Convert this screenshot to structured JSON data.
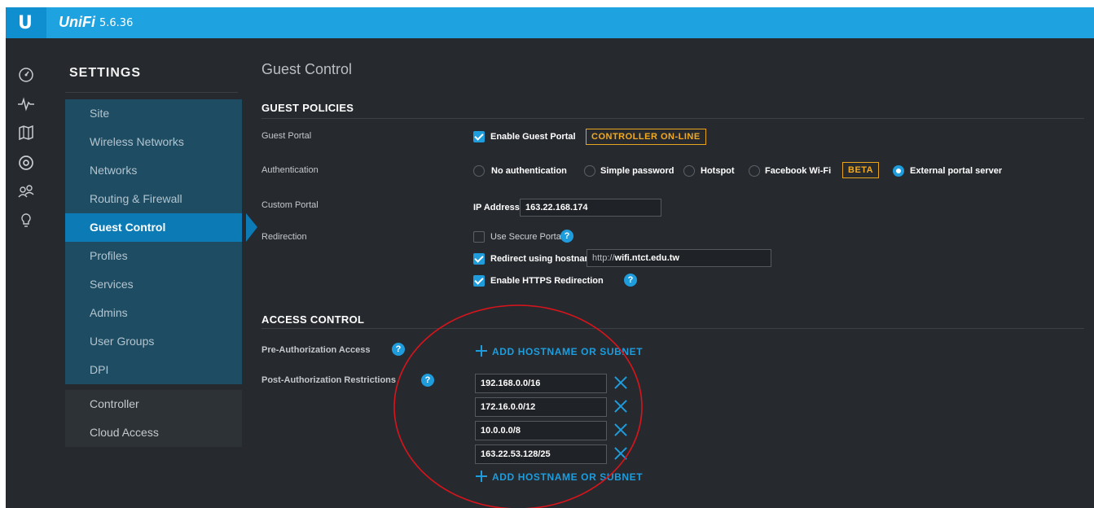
{
  "app": {
    "logo": "U",
    "brand": "UniFi",
    "version": "5.6.36"
  },
  "rail": {
    "icons": [
      "dashboard-icon",
      "statistics-icon",
      "map-icon",
      "devices-icon",
      "clients-icon",
      "insights-icon"
    ]
  },
  "sidebar": {
    "title": "SETTINGS",
    "items": [
      {
        "label": "Site"
      },
      {
        "label": "Wireless Networks"
      },
      {
        "label": "Networks"
      },
      {
        "label": "Routing & Firewall"
      },
      {
        "label": "Guest Control",
        "active": true
      },
      {
        "label": "Profiles"
      },
      {
        "label": "Services"
      },
      {
        "label": "Admins"
      },
      {
        "label": "User Groups"
      },
      {
        "label": "DPI"
      }
    ],
    "secondary_items": [
      {
        "label": "Controller"
      },
      {
        "label": "Cloud Access"
      }
    ]
  },
  "page": {
    "title": "Guest Control",
    "guest_policies": {
      "title": "GUEST POLICIES",
      "guest_portal": {
        "label": "Guest Portal",
        "checkbox_label": "Enable Guest Portal",
        "checked": true,
        "badge": "CONTROLLER ON-LINE"
      },
      "authentication": {
        "label": "Authentication",
        "options": [
          {
            "label": "No authentication",
            "selected": false
          },
          {
            "label": "Simple password",
            "selected": false
          },
          {
            "label": "Hotspot",
            "selected": false
          },
          {
            "label": "Facebook Wi-Fi",
            "selected": false
          },
          {
            "label": "External portal server",
            "selected": true
          }
        ],
        "beta_badge": "BETA"
      },
      "custom_portal": {
        "label": "Custom Portal",
        "ip_label": "IP Address",
        "ip_value": "163.22.168.174"
      },
      "redirection": {
        "label": "Redirection",
        "secure_portal": {
          "label": "Use Secure Portal",
          "checked": false
        },
        "redirect_hostname": {
          "label": "Redirect using hostname",
          "checked": true,
          "prefix": "http://",
          "value": "wifi.ntct.edu.tw"
        },
        "https_redirection": {
          "label": "Enable HTTPS Redirection",
          "checked": true
        }
      }
    },
    "access_control": {
      "title": "ACCESS CONTROL",
      "pre_auth": {
        "label": "Pre-Authorization Access",
        "add_label": "ADD HOSTNAME OR SUBNET"
      },
      "post_auth": {
        "label": "Post-Authorization Restrictions",
        "entries": [
          "192.168.0.0/16",
          "172.16.0.0/12",
          "10.0.0.0/8",
          "163.22.53.128/25"
        ],
        "add_label": "ADD HOSTNAME OR SUBNET"
      }
    }
  },
  "help_glyph": "?",
  "colors": {
    "accent": "#1f9cdc",
    "topbar": "#1ea2e0",
    "badge": "#f2a922",
    "annotation": "#d9141b"
  }
}
